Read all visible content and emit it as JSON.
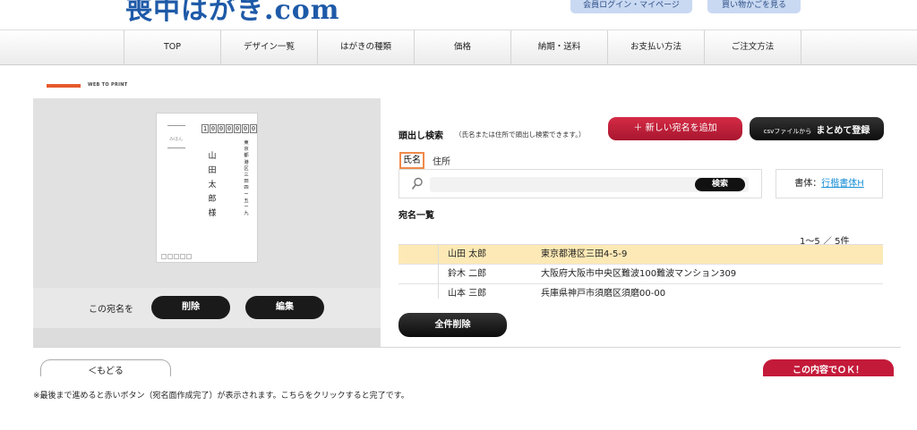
{
  "header": {
    "logo": "喪中はがき.com",
    "login_button": "会員ログイン・マイページ",
    "cart_button": "買い物かごを見る"
  },
  "nav": {
    "items": [
      "TOP",
      "デザイン一覧",
      "はがきの種類",
      "価格",
      "納期・送料",
      "お支払い方法",
      "ご注文方法"
    ]
  },
  "brand": {
    "tagline": "WEB TO PRINT"
  },
  "preview": {
    "mihon": "みほん",
    "zip_digits": [
      "1",
      "0",
      "0",
      "0",
      "0",
      "0",
      "0"
    ],
    "name_vertical": "山田太郎様",
    "address_vertical": "東京都港区三田四ー五ー九",
    "action_label": "この宛名を",
    "delete_button": "削除",
    "edit_button": "編集"
  },
  "search": {
    "title": "頭出し検索",
    "note": "（氏名または住所で頭出し検索できます。）",
    "add_button": "＋ 新しい宛名を追加",
    "csv_small": "csvファイルから",
    "csv_big": "まとめて登録",
    "tab_name": "氏名",
    "tab_address": "住所",
    "search_button": "検索",
    "font_label": "書体：",
    "font_link": "行楷書体H"
  },
  "list": {
    "title": "宛名一覧",
    "count": "1〜5 ／ 5件",
    "rows": [
      {
        "name": "山田 太郎",
        "address": "東京都港区三田4-5-9",
        "selected": true
      },
      {
        "name": "鈴木 二郎",
        "address": "大阪府大阪市中央区難波100難波マンション309",
        "selected": false
      },
      {
        "name": "山本 三郎",
        "address": "兵庫県神戸市須磨区須磨00-00",
        "selected": false
      }
    ],
    "delete_all_button": "全件削除"
  },
  "footer": {
    "back_button": "＜もどる",
    "ok_button": "この内容でＯＫ！",
    "note": "※最後まで進めると赤いボタン（宛名面作成完了）が表示されます。こちらをクリックすると完了です。"
  },
  "colors": {
    "brand_blue": "#1e5aa8",
    "accent_red": "#c41a3a",
    "selected_row": "#fde9b5",
    "tab_outline": "#f08a4b",
    "link": "#1a8fd6"
  }
}
